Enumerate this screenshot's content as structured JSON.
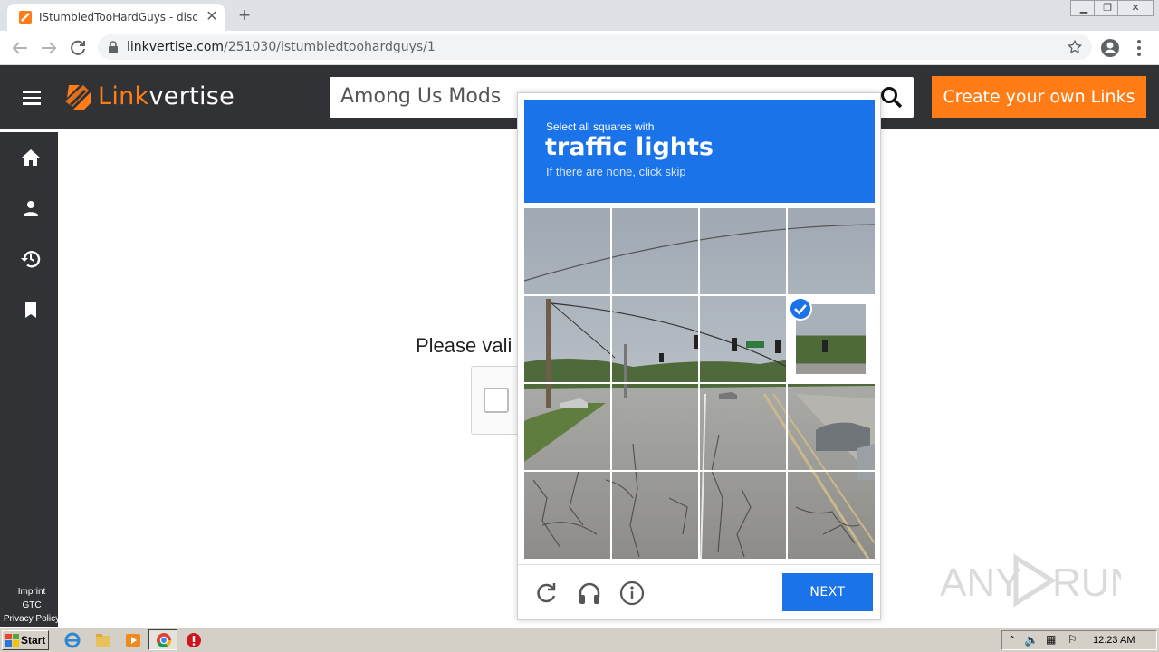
{
  "browser": {
    "tab_title": "IStumbledTooHardGuys - discord.gg",
    "url_host": "linkvertise.com",
    "url_path": "/251030/istumbledtoohardguys/1"
  },
  "header": {
    "logo_prefix": "Link",
    "logo_suffix": "vertise",
    "search_value": "Among Us Mods",
    "create_button": "Create your own Links",
    "accent_color": "#ff7c17"
  },
  "sidebar": {
    "items": [
      "home-icon",
      "user-icon",
      "history-icon",
      "bookmark-icon"
    ],
    "footer_links": [
      "Imprint",
      "GTC",
      "Privacy Policy"
    ]
  },
  "page": {
    "validate_text": "Please vali"
  },
  "captcha": {
    "instruction_small": "Select all squares with",
    "target": "traffic lights",
    "hint": "If there are none, click skip",
    "next_button": "NEXT",
    "accent_color": "#1a73e8",
    "selected_tiles": [
      7
    ],
    "controls": [
      "refresh-icon",
      "audio-icon",
      "info-icon"
    ]
  },
  "watermark": "ANY RUN",
  "taskbar": {
    "start_label": "Start",
    "clock": "12:23 AM"
  }
}
